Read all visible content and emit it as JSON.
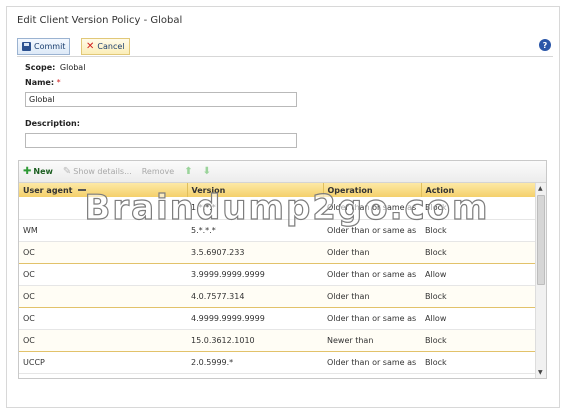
{
  "window": {
    "title": "Edit Client Version Policy - Global"
  },
  "toolbar": {
    "commit_label": "Commit",
    "cancel_label": "Cancel",
    "help_label": "?"
  },
  "form": {
    "scope_label": "Scope:",
    "scope_value": "Global",
    "name_label": "Name:",
    "required_mark": "*",
    "name_value": "Global",
    "description_label": "Description:",
    "description_value": ""
  },
  "grid_toolbar": {
    "new_label": "New",
    "show_details_label": "Show details...",
    "remove_label": "Remove"
  },
  "table": {
    "columns": [
      "User agent",
      "Version",
      "Operation",
      "Action"
    ],
    "rows": [
      {
        "user_agent": "",
        "version": "1.*.*.*",
        "operation": "Older than or same as",
        "action": "Block"
      },
      {
        "user_agent": "WM",
        "version": "5.*.*.*",
        "operation": "Older than or same as",
        "action": "Block"
      },
      {
        "user_agent": "OC",
        "version": "3.5.6907.233",
        "operation": "Older than",
        "action": "Block"
      },
      {
        "user_agent": "OC",
        "version": "3.9999.9999.9999",
        "operation": "Older than or same as",
        "action": "Allow"
      },
      {
        "user_agent": "OC",
        "version": "4.0.7577.314",
        "operation": "Older than",
        "action": "Block"
      },
      {
        "user_agent": "OC",
        "version": "4.9999.9999.9999",
        "operation": "Older than or same as",
        "action": "Allow"
      },
      {
        "user_agent": "OC",
        "version": "15.0.3612.1010",
        "operation": "Newer than",
        "action": "Block"
      },
      {
        "user_agent": "UCCP",
        "version": "2.0.5999.*",
        "operation": "Older than or same as",
        "action": "Block"
      }
    ]
  },
  "watermark": "Braindump2go.com",
  "icons": {
    "commit": "floppy-disk-icon",
    "cancel": "x-icon",
    "help": "help-icon",
    "new": "plus-icon",
    "show_details": "pencil-icon",
    "move_up": "arrow-up-icon",
    "move_down": "arrow-down-icon"
  },
  "colors": {
    "header_gold": "#f4d06b",
    "highlight_border": "#e2c26a",
    "help_blue": "#2a56a8",
    "cancel_red": "#d02020",
    "new_green": "#2e9a35"
  }
}
